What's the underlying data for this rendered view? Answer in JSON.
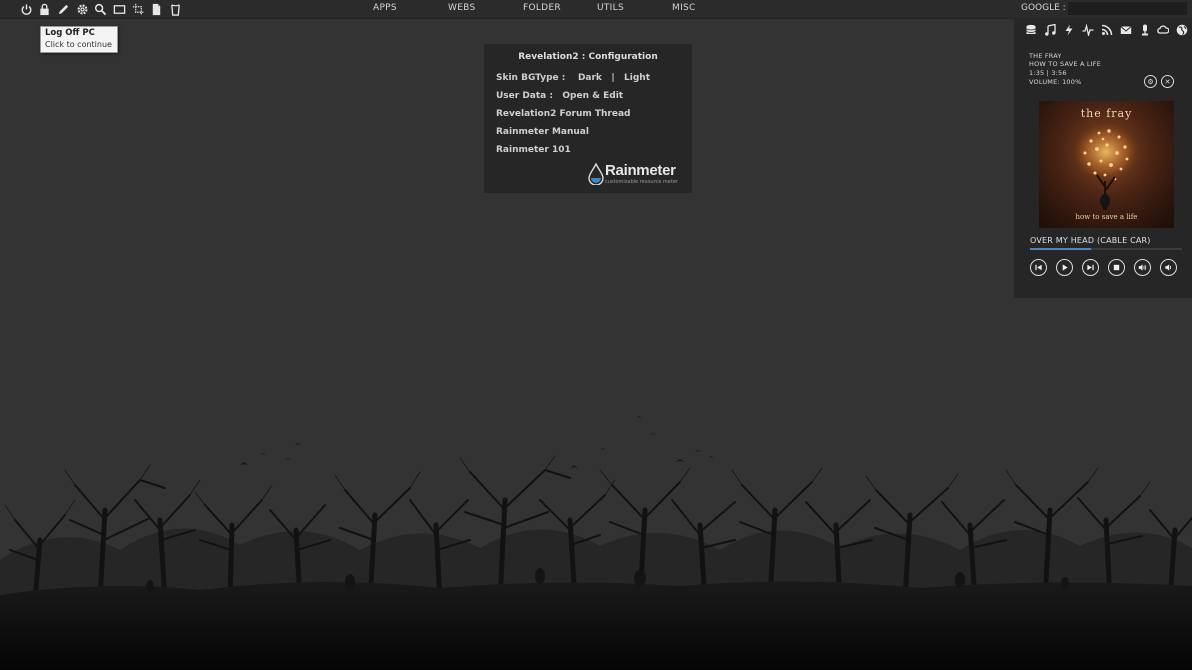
{
  "topbar": {
    "icons": [
      "power-icon",
      "lock-icon",
      "pencil-icon",
      "gear-icon",
      "search-icon",
      "window-icon",
      "crop-icon",
      "document-icon",
      "recycle-bin-icon"
    ],
    "menus": [
      "APPS",
      "WEBS",
      "FOLDER",
      "UTILS",
      "MISC"
    ],
    "google_label": "GOOGLE :",
    "google_value": ""
  },
  "tooltip": {
    "title": "Log Off PC",
    "text": "Click to continue"
  },
  "config": {
    "title": "Revelation2 : Configuration",
    "skin_bgtype_label": "Skin BGType :",
    "skin_dark": "Dark",
    "separator": "|",
    "skin_light": "Light",
    "user_data_label": "User Data :",
    "user_data_action": "Open & Edit",
    "forum_thread": "Revelation2 Forum Thread",
    "manual": "Rainmeter Manual",
    "rainmeter_101": "Rainmeter 101",
    "logo_text": "Rainmeter",
    "logo_tagline": "customizable resource meter"
  },
  "media": {
    "icons": [
      "database-icon",
      "music-icon",
      "lightning-icon",
      "pulse-icon",
      "rss-icon",
      "mail-icon",
      "microphone-icon",
      "weather-icon",
      "globe-icon"
    ],
    "artist": "THE FRAY",
    "album": "HOW TO SAVE A LIFE",
    "time": "1:35 | 3:56",
    "volume": "VOLUME: 100%",
    "album_art_band": "the fray",
    "album_art_title": "how to save a life",
    "song": "OVER MY HEAD (CABLE CAR)",
    "progress": 0.4
  },
  "colors": {
    "background": "#333333",
    "panel": "#262626",
    "accent": "#4e84b8",
    "tooltip_bg": "#f4f4f4"
  }
}
